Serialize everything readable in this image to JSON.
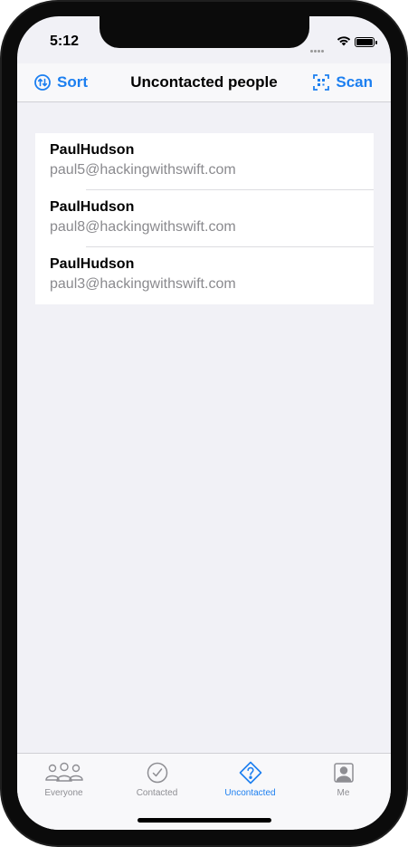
{
  "status": {
    "time": "5:12"
  },
  "navbar": {
    "left_button": {
      "label": "Sort",
      "icon": "sort-arrows-icon"
    },
    "title": "Uncontacted people",
    "right_button": {
      "label": "Scan",
      "icon": "qr-scan-icon"
    }
  },
  "list": {
    "items": [
      {
        "name": "PaulHudson",
        "email": "paul5@hackingwithswift.com"
      },
      {
        "name": "PaulHudson",
        "email": "paul8@hackingwithswift.com"
      },
      {
        "name": "PaulHudson",
        "email": "paul3@hackingwithswift.com"
      }
    ]
  },
  "tabs": [
    {
      "label": "Everyone",
      "icon": "people-icon",
      "selected": false
    },
    {
      "label": "Contacted",
      "icon": "checkmark-circle-icon",
      "selected": false
    },
    {
      "label": "Uncontacted",
      "icon": "questionmark-diamond-icon",
      "selected": true
    },
    {
      "label": "Me",
      "icon": "person-square-icon",
      "selected": false
    }
  ],
  "colors": {
    "accent": "#1c7ff0",
    "inactive": "#8e8e93",
    "background": "#f1f1f6"
  }
}
